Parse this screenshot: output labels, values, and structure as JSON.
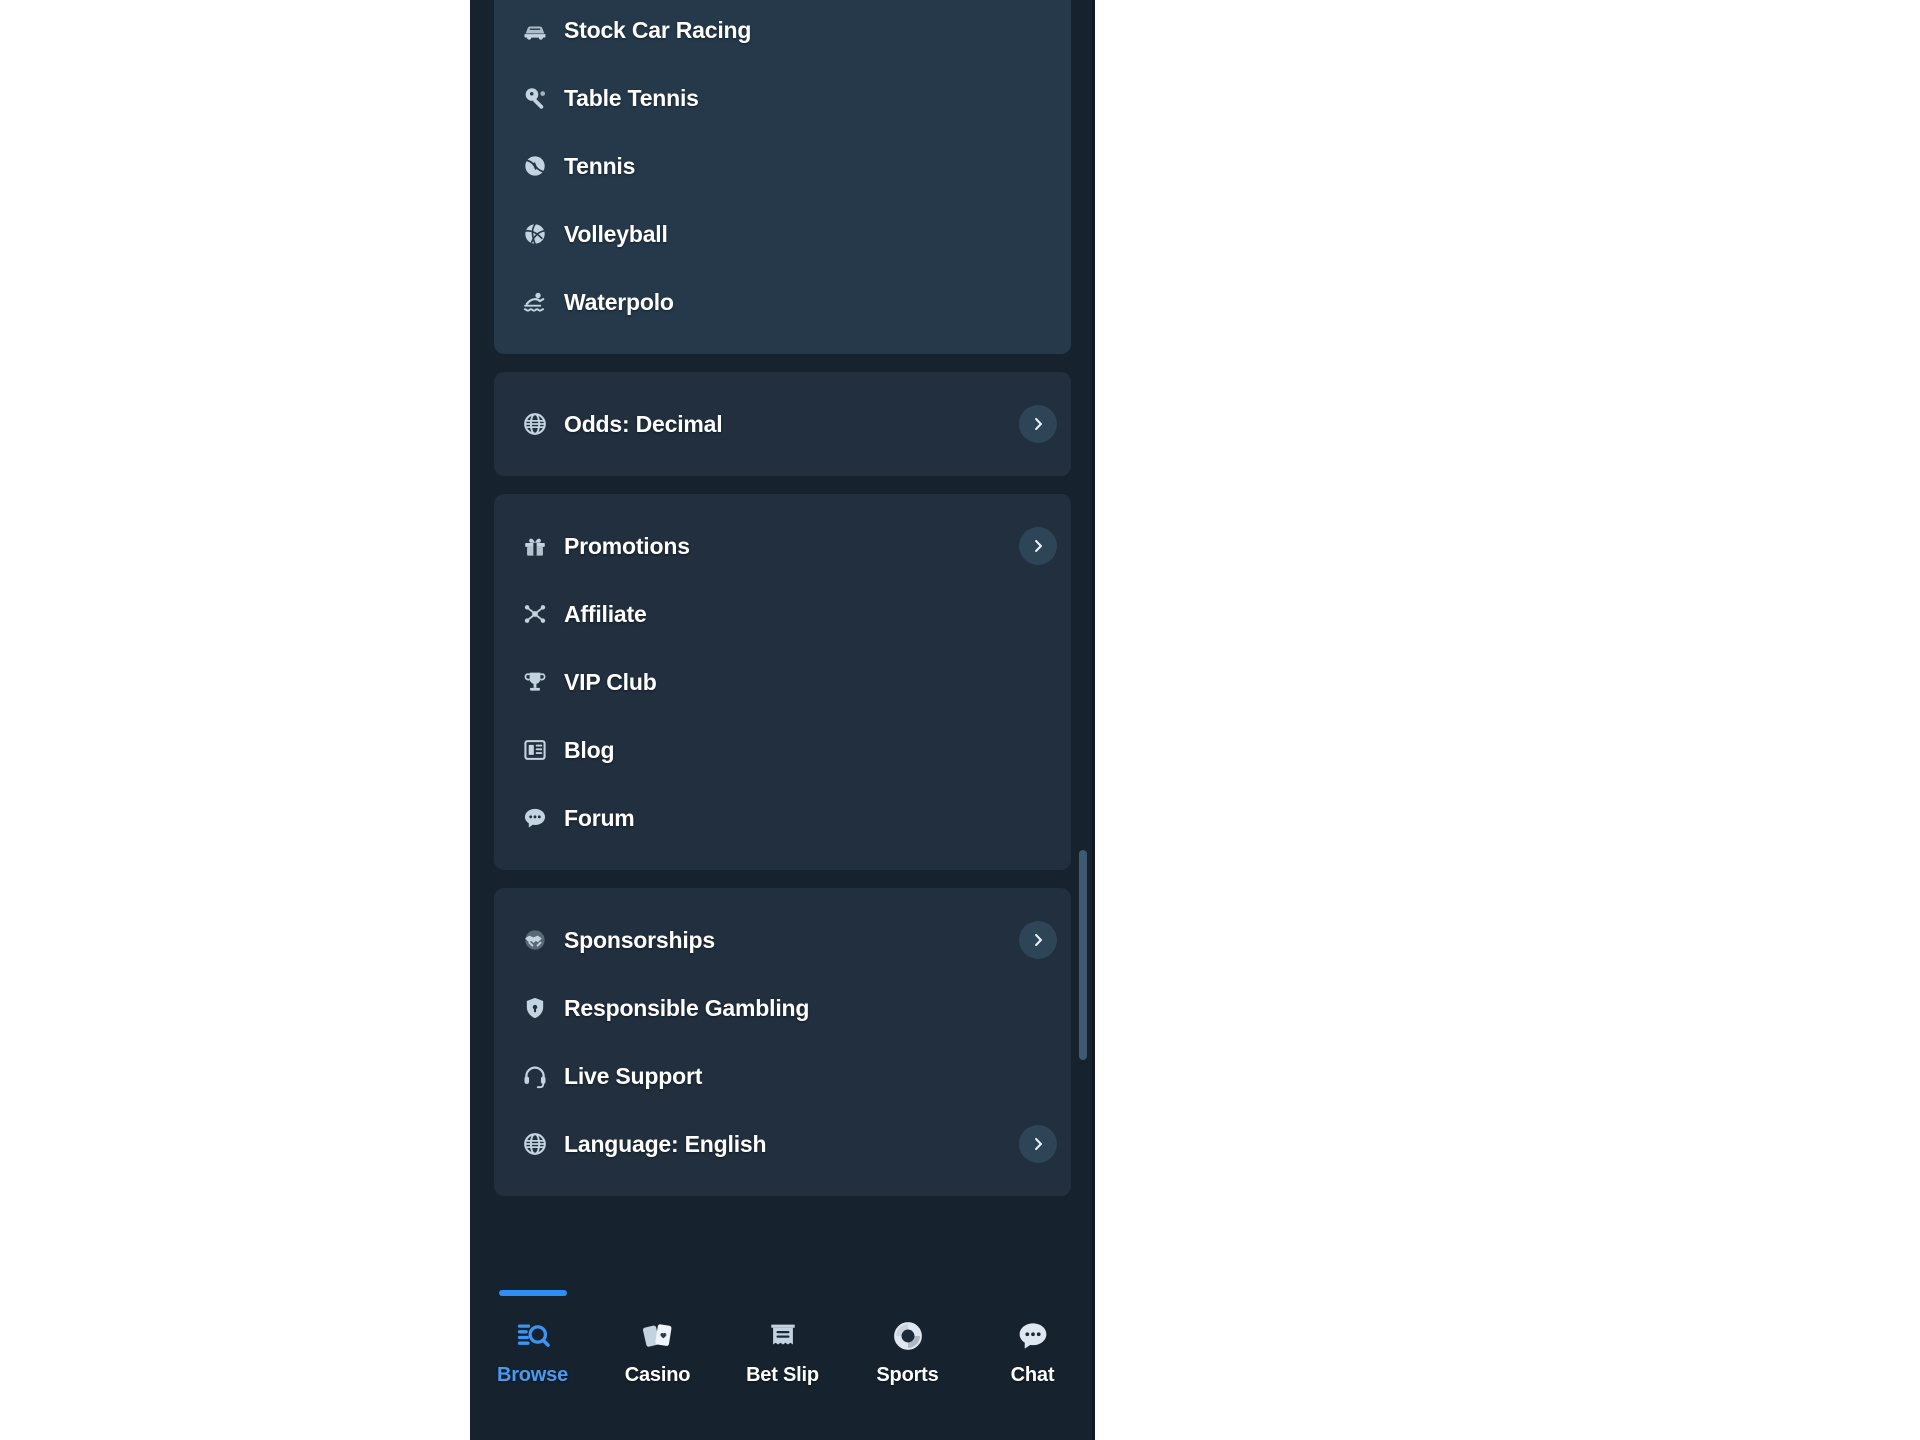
{
  "app": {
    "platform": "mobile-sportsbook",
    "active_nav": "Browse",
    "colors": {
      "page_bg": "#16222e",
      "card_bg": "#212f3e",
      "sports_card_bg": "#25394a",
      "accent": "#2f8ef4",
      "active_label": "#4a9bf0",
      "chevron_bg": "#2e4557",
      "scrollbar_thumb": "#3f5a70",
      "text": "#ffffff"
    }
  },
  "sections": [
    {
      "id": "sports-list",
      "name": "sports-category-list",
      "style": "sports",
      "items": [
        {
          "label": "Stock Car Racing",
          "icon": "stock-car-racing-icon",
          "chevron": false
        },
        {
          "label": "Table Tennis",
          "icon": "table-tennis-icon",
          "chevron": false
        },
        {
          "label": "Tennis",
          "icon": "tennis-ball-icon",
          "chevron": false
        },
        {
          "label": "Volleyball",
          "icon": "volleyball-icon",
          "chevron": false
        },
        {
          "label": "Waterpolo",
          "icon": "waterpolo-icon",
          "chevron": false
        }
      ]
    },
    {
      "id": "odds-settings",
      "name": "odds-settings-section",
      "style": "card",
      "items": [
        {
          "label": "Odds: Decimal",
          "icon": "globe-icon",
          "chevron": true
        }
      ]
    },
    {
      "id": "promotions",
      "name": "promotions-section",
      "style": "card",
      "items": [
        {
          "label": "Promotions",
          "icon": "gift-icon",
          "chevron": true
        },
        {
          "label": "Affiliate",
          "icon": "affiliate-icon",
          "chevron": false
        },
        {
          "label": "VIP Club",
          "icon": "trophy-icon",
          "chevron": false
        },
        {
          "label": "Blog",
          "icon": "blog-icon",
          "chevron": false
        },
        {
          "label": "Forum",
          "icon": "forum-icon",
          "chevron": false
        }
      ]
    },
    {
      "id": "support",
      "name": "support-section",
      "style": "card",
      "items": [
        {
          "label": "Sponsorships",
          "icon": "handshake-icon",
          "chevron": true
        },
        {
          "label": "Responsible Gambling",
          "icon": "shield-icon",
          "chevron": false
        },
        {
          "label": "Live Support",
          "icon": "headset-icon",
          "chevron": false
        },
        {
          "label": "Language: English",
          "icon": "globe-icon",
          "chevron": true
        }
      ]
    }
  ],
  "bottom_nav": {
    "items": [
      {
        "label": "Browse",
        "icon": "browse-search-icon",
        "active": true
      },
      {
        "label": "Casino",
        "icon": "playing-cards-icon",
        "active": false
      },
      {
        "label": "Bet Slip",
        "icon": "bet-slip-icon",
        "active": false
      },
      {
        "label": "Sports",
        "icon": "basketball-icon",
        "active": false
      },
      {
        "label": "Chat",
        "icon": "chat-bubble-icon",
        "active": false
      }
    ]
  }
}
